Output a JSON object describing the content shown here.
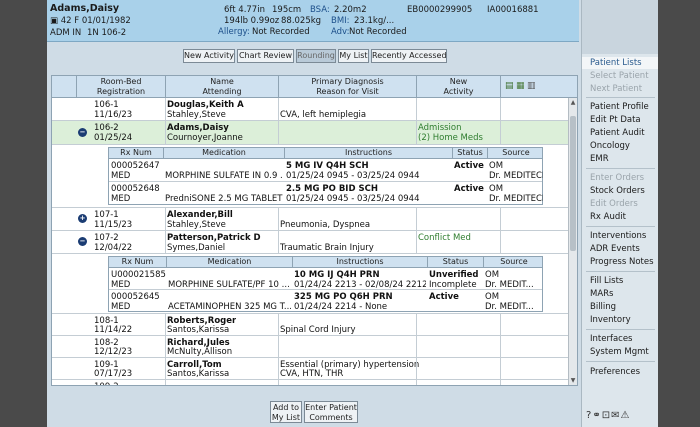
{
  "header": {
    "patient_name": "Adams,Daisy",
    "age_sex_dob": "42 F 01/01/1982",
    "adm": "ADM IN",
    "location": "1N 106-2",
    "height": "6ft 4.77in",
    "height_cm": "195cm",
    "bsa_label": "BSA:",
    "bsa_value": "2.20m2",
    "weight": "194lb 0.99oz",
    "weight_kg": "88.025kg",
    "bmi_label": "BMI:",
    "bmi_value": "23.1kg/...",
    "allergy_label": "Allergy:",
    "allergy_value": "Not Recorded",
    "adv_label": "Adv:",
    "adv_value": "Not Recorded",
    "eb_number": "EB0000299905",
    "ia_number": "IA00016881"
  },
  "toolbar": {
    "new_activity": "New Activity",
    "chart_review": "Chart Review",
    "rounding": "Rounding",
    "my_list": "My List",
    "recently_accessed": "Recently Accessed"
  },
  "table": {
    "headers": {
      "room_bed_1": "Room-Bed",
      "room_bed_2": "Registration",
      "name_1": "Name",
      "name_2": "Attending",
      "diag_1": "Primary Diagnosis",
      "diag_2": "Reason for Visit",
      "activity_1": "New",
      "activity_2": "Activity"
    },
    "rows": [
      {
        "room": "106-1",
        "reg": "11/16/23",
        "name": "Douglas,Keith A",
        "attending": "Stahley,Steve",
        "diag1": "CVA, left hemiplegia",
        "diag2": "",
        "act1": "",
        "act2": ""
      },
      {
        "room": "106-2",
        "reg": "01/25/24",
        "name": "Adams,Daisy",
        "attending": "Cournoyer,Joanne",
        "diag1": "",
        "diag2": "",
        "act1": "Admission",
        "act2": "(2) Home Meds"
      },
      {
        "room": "107-1",
        "reg": "11/15/23",
        "name": "Alexander,Bill",
        "attending": "Stahley,Steve",
        "diag1": "Pneumonia, Dyspnea",
        "diag2": "",
        "act1": "",
        "act2": ""
      },
      {
        "room": "107-2",
        "reg": "12/04/22",
        "name": "Patterson,Patrick D",
        "attending": "Symes,Daniel",
        "diag1": "Traumatic Brain Injury",
        "diag2": "",
        "act1": "Conflict Med",
        "act2": ""
      },
      {
        "room": "108-1",
        "reg": "11/14/22",
        "name": "Roberts,Roger",
        "attending": "Santos,Karissa",
        "diag1": "Spinal Cord Injury",
        "diag2": "",
        "act1": "",
        "act2": ""
      },
      {
        "room": "108-2",
        "reg": "12/12/23",
        "name": "Richard,Jules",
        "attending": "McNulty,Allison",
        "diag1": "",
        "diag2": "",
        "act1": "",
        "act2": ""
      },
      {
        "room": "109-1",
        "reg": "07/17/23",
        "name": "Carroll,Tom",
        "attending": "Santos,Karissa",
        "diag1": "Essential (primary) hypertension",
        "diag2": "CVA, HTN, THR",
        "act1": "",
        "act2": ""
      }
    ],
    "partial_row_room": "109-2"
  },
  "med_headers": {
    "rx": "Rx Num",
    "medication": "Medication",
    "instructions": "Instructions",
    "status": "Status",
    "source": "Source"
  },
  "meds_adams": [
    {
      "rx": "000052647",
      "type": "MED",
      "medication": "MORPHINE SULFATE IN 0.9 ...",
      "instr1": "5 MG IV Q4H SCH",
      "instr2": "01/25/24 0945 - 03/25/24 0944",
      "status1": "Active",
      "status2": "",
      "source1": "OM",
      "source2": "Dr. MEDITECH"
    },
    {
      "rx": "000052648",
      "type": "MED",
      "medication": "PredniSONE 2.5 MG TABLET",
      "instr1": "2.5 MG PO BID SCH",
      "instr2": "01/25/24 0945 - 03/25/24 0944",
      "status1": "Active",
      "status2": "",
      "source1": "OM",
      "source2": "Dr. MEDITECH"
    }
  ],
  "meds_patterson": [
    {
      "rx": "U000021585",
      "type": "MED",
      "medication": "MORPHINE SULFATE/PF 10 ...",
      "instr1": "10 MG IJ Q4H PRN",
      "instr2": "01/24/24 2213 - 02/08/24 2212",
      "status1": "Unverified",
      "status2": "Incomplete",
      "source1": "OM",
      "source2": "Dr. MEDIT..."
    },
    {
      "rx": "000052645",
      "type": "MED",
      "medication": "ACETAMINOPHEN 325 MG T...",
      "instr1": "325 MG PO Q6H PRN",
      "instr2": "01/24/24 2214 - None",
      "status1": "Active",
      "status2": "",
      "source1": "OM",
      "source2": "Dr. MEDIT..."
    }
  ],
  "bottom": {
    "add_1": "Add to",
    "add_2": "My List",
    "enter_1": "Enter Patient",
    "enter_2": "Comments"
  },
  "sidebar": {
    "patient_lists": "Patient Lists",
    "select_patient": "Select Patient",
    "next_patient": "Next Patient",
    "patient_profile": "Patient Profile",
    "edit_pt_data": "Edit Pt Data",
    "patient_audit": "Patient Audit",
    "oncology": "Oncology",
    "emr": "EMR",
    "enter_orders": "Enter Orders",
    "stock_orders": "Stock Orders",
    "edit_orders": "Edit Orders",
    "rx_audit": "Rx Audit",
    "interventions": "Interventions",
    "adr_events": "ADR Events",
    "progress_notes": "Progress Notes",
    "fill_lists": "Fill Lists",
    "mars": "MARs",
    "billing": "Billing",
    "inventory": "Inventory",
    "interfaces": "Interfaces",
    "system_mgmt": "System Mgmt",
    "preferences": "Preferences"
  },
  "icons": [
    "help-icon",
    "link-icon",
    "lock-icon",
    "mail-icon",
    "warning-icon"
  ]
}
